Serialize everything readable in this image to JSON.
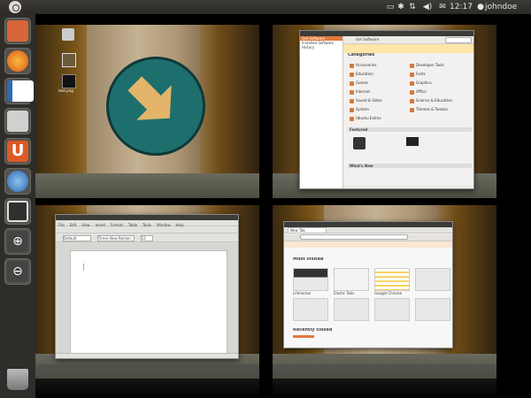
{
  "topbar": {
    "clock": "12:17",
    "username": "johndoe",
    "indicators": [
      "display-icon",
      "bluetooth-icon",
      "network-icon",
      "volume-icon",
      "mail-icon"
    ]
  },
  "launcher": {
    "items": [
      {
        "name": "home-folder",
        "icon": "home-folder-icon",
        "color": "#d9653b"
      },
      {
        "name": "firefox",
        "icon": "firefox-icon",
        "color": "#e77b22"
      },
      {
        "name": "writer",
        "icon": "libreoffice-writer-icon",
        "color": "#2b6cb2"
      },
      {
        "name": "shotwell",
        "icon": "camera-icon",
        "color": "#9a9a9a"
      },
      {
        "name": "software-center",
        "icon": "software-center-icon",
        "color": "#dd5a25"
      },
      {
        "name": "empathy",
        "icon": "chat-icon",
        "color": "#3a7fc5"
      },
      {
        "name": "workspaces",
        "icon": "workspace-switcher-icon",
        "color": "#444444"
      },
      {
        "name": "zoom-in",
        "icon": "zoom-in-icon",
        "color": "#555555"
      },
      {
        "name": "zoom-out",
        "icon": "zoom-out-icon",
        "color": "#555555"
      },
      {
        "name": "trash",
        "icon": "trash-icon",
        "color": "#8a8a8a"
      }
    ]
  },
  "workspaces": {
    "ws1": {
      "desktop_icons": [
        {
          "label": ""
        },
        {
          "label": ""
        },
        {
          "label": "text.png"
        }
      ]
    },
    "ws2": {
      "window": "Ubuntu Software Center",
      "sidebar": [
        "Get Software",
        "Installed Software",
        "History"
      ],
      "toolbar_label": "Get Software",
      "categories_title": "Categories",
      "categories_left": [
        "Accessories",
        "Education",
        "Games",
        "Internet",
        "Sound & Video",
        "System",
        "Ubuntu Extras"
      ],
      "categories_right": [
        "Developer Tools",
        "Fonts",
        "Graphics",
        "Office",
        "Science & Education",
        "Themes & Tweaks"
      ],
      "featured_title": "Featured",
      "whats_new_title": "What's New"
    },
    "ws3": {
      "window": "LibreOffice Writer",
      "menu": [
        "File",
        "Edit",
        "View",
        "Insert",
        "Format",
        "Table",
        "Tools",
        "Window",
        "Help"
      ],
      "style": "Default",
      "font": "Times New Roman",
      "size": "12"
    },
    "ws4": {
      "window": "Firefox",
      "tab": "New Tab",
      "most_visited_title": "Most visited",
      "thumbs": [
        "Lifehacker",
        "Elastic Tabs",
        "Google Chrome"
      ],
      "recently_closed_title": "Recently closed"
    }
  }
}
